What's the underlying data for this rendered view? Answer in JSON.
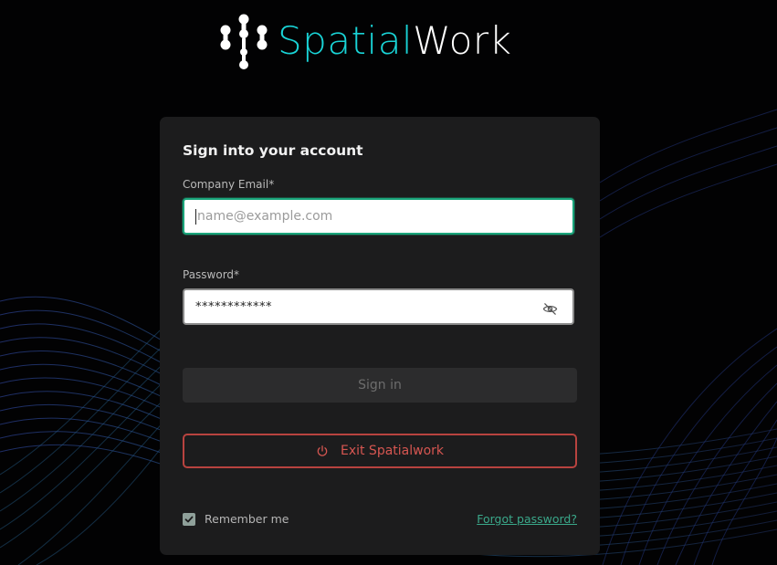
{
  "logo": {
    "part1": "Spatial",
    "part2": "Work",
    "colors": {
      "accent": "#19d3d6",
      "text": "#ffffff"
    }
  },
  "form": {
    "title": "Sign into your account",
    "email": {
      "label": "Company Email*",
      "placeholder": "name@example.com",
      "value": ""
    },
    "password": {
      "label": "Password*",
      "value": "************",
      "toggle_icon": "eye-off-icon"
    },
    "signin_label": "Sign in",
    "exit_label": "Exit Spatialwork",
    "exit_icon": "power-icon",
    "remember_label": "Remember me",
    "remember_checked": true,
    "forgot_label": "Forgot password?"
  },
  "colors": {
    "focus_border": "#1aa57b",
    "danger": "#d65651",
    "link": "#3aa88a",
    "card_bg": "#1c1c1d"
  }
}
